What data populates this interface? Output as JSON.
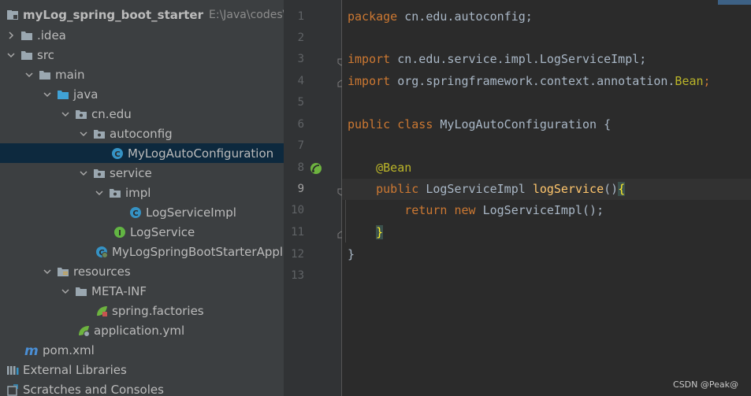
{
  "project_tree": {
    "root": {
      "name": "myLog_spring_boot_starter",
      "path": "E:\\Java\\codes\\ss"
    },
    "items": [
      {
        "label": ".idea"
      },
      {
        "label": "src"
      },
      {
        "label": "main"
      },
      {
        "label": "java"
      },
      {
        "label": "cn.edu"
      },
      {
        "label": "autoconfig"
      },
      {
        "label": "MyLogAutoConfiguration"
      },
      {
        "label": "service"
      },
      {
        "label": "impl"
      },
      {
        "label": "LogServiceImpl"
      },
      {
        "label": "LogService"
      },
      {
        "label": "MyLogSpringBootStarterAppl"
      },
      {
        "label": "resources"
      },
      {
        "label": "META-INF"
      },
      {
        "label": "spring.factories"
      },
      {
        "label": "application.yml"
      },
      {
        "label": "pom.xml"
      },
      {
        "label": "External Libraries"
      },
      {
        "label": "Scratches and Consoles"
      }
    ]
  },
  "editor": {
    "line_numbers": [
      "1",
      "2",
      "3",
      "4",
      "5",
      "6",
      "7",
      "8",
      "9",
      "10",
      "11",
      "12",
      "13"
    ],
    "lines": {
      "l1": {
        "kw": "package",
        "rest": " cn.edu.autoconfig;"
      },
      "l3": {
        "kw": "import",
        "rest": " cn.edu.service.impl.LogServiceImpl;"
      },
      "l4": {
        "kw": "import",
        "rest": " org.springframework.context.annotation.",
        "cls": "Bean",
        "end": ";"
      },
      "l6": {
        "kw1": "public",
        "kw2": "class",
        "rest": " MyLogAutoConfiguration {"
      },
      "l8": {
        "ann": "@Bean"
      },
      "l9": {
        "kw": "public",
        "type": " LogServiceImpl ",
        "fn": "logService",
        "paren": "()",
        "brace": "{"
      },
      "l10": {
        "kw1": "return",
        "kw2": "new",
        "rest": " LogServiceImpl();"
      },
      "l11": {
        "brace": "}"
      },
      "l12": {
        "brace": "}"
      }
    }
  },
  "watermark": "CSDN @Peak@",
  "colors": {
    "tree_bg": "#3c3f41",
    "editor_bg": "#2b2b2b",
    "selection": "#0d293e",
    "keyword": "#cc7832",
    "annotation": "#bbb529",
    "method": "#ffc66d",
    "text": "#a9b7c6",
    "class_icon": "#3592c4",
    "interface_icon": "#62b543",
    "maven_icon": "#4a8fd6"
  }
}
